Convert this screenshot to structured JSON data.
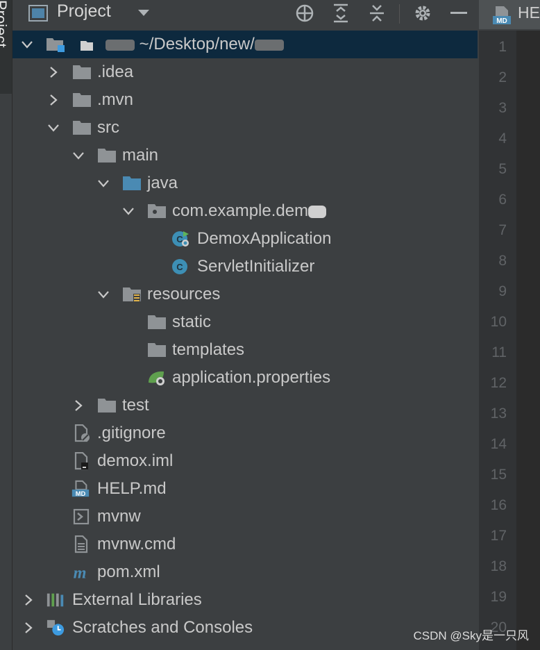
{
  "side_strip": {
    "label": "Project"
  },
  "toolbar": {
    "title": "Project"
  },
  "editor_tab": {
    "label": "HE"
  },
  "tree": {
    "root": {
      "path": "~/Desktop/new/"
    },
    "items": [
      {
        "label": ".idea"
      },
      {
        "label": ".mvn"
      },
      {
        "label": "src"
      },
      {
        "label": "main"
      },
      {
        "label": "java"
      },
      {
        "label": "com.example.dem"
      },
      {
        "label": "DemoxApplication"
      },
      {
        "label": "ServletInitializer"
      },
      {
        "label": "resources"
      },
      {
        "label": "static"
      },
      {
        "label": "templates"
      },
      {
        "label": "application.properties"
      },
      {
        "label": "test"
      },
      {
        "label": ".gitignore"
      },
      {
        "label": "demox.iml"
      },
      {
        "label": "HELP.md"
      },
      {
        "label": "mvnw"
      },
      {
        "label": "mvnw.cmd"
      },
      {
        "label": "pom.xml"
      },
      {
        "label": "External Libraries"
      },
      {
        "label": "Scratches and Consoles"
      }
    ]
  },
  "line_numbers": [
    "1",
    "2",
    "3",
    "4",
    "5",
    "6",
    "7",
    "8",
    "9",
    "10",
    "11",
    "12",
    "13",
    "14",
    "15",
    "16",
    "17",
    "18",
    "19",
    "20"
  ],
  "watermark": "CSDN @Sky是一只风",
  "colors": {
    "selection": "#0d293e",
    "background": "#3c3f41",
    "folder": "#8f9396",
    "source_folder": "#4a8ab3"
  }
}
